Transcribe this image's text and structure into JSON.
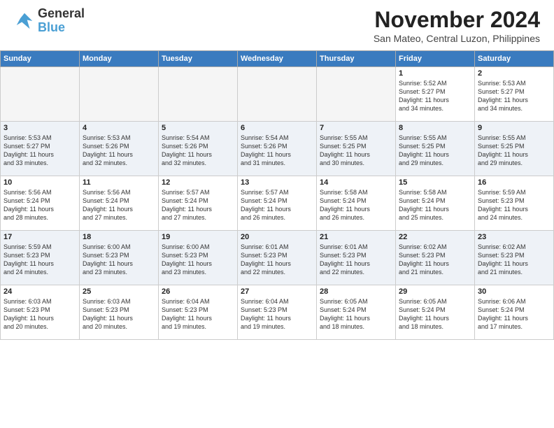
{
  "header": {
    "logo_text_general": "General",
    "logo_text_blue": "Blue",
    "month": "November 2024",
    "location": "San Mateo, Central Luzon, Philippines"
  },
  "calendar": {
    "days_of_week": [
      "Sunday",
      "Monday",
      "Tuesday",
      "Wednesday",
      "Thursday",
      "Friday",
      "Saturday"
    ],
    "weeks": [
      [
        {
          "day": "",
          "info": ""
        },
        {
          "day": "",
          "info": ""
        },
        {
          "day": "",
          "info": ""
        },
        {
          "day": "",
          "info": ""
        },
        {
          "day": "",
          "info": ""
        },
        {
          "day": "1",
          "info": "Sunrise: 5:52 AM\nSunset: 5:27 PM\nDaylight: 11 hours\nand 34 minutes."
        },
        {
          "day": "2",
          "info": "Sunrise: 5:53 AM\nSunset: 5:27 PM\nDaylight: 11 hours\nand 34 minutes."
        }
      ],
      [
        {
          "day": "3",
          "info": "Sunrise: 5:53 AM\nSunset: 5:27 PM\nDaylight: 11 hours\nand 33 minutes."
        },
        {
          "day": "4",
          "info": "Sunrise: 5:53 AM\nSunset: 5:26 PM\nDaylight: 11 hours\nand 32 minutes."
        },
        {
          "day": "5",
          "info": "Sunrise: 5:54 AM\nSunset: 5:26 PM\nDaylight: 11 hours\nand 32 minutes."
        },
        {
          "day": "6",
          "info": "Sunrise: 5:54 AM\nSunset: 5:26 PM\nDaylight: 11 hours\nand 31 minutes."
        },
        {
          "day": "7",
          "info": "Sunrise: 5:55 AM\nSunset: 5:25 PM\nDaylight: 11 hours\nand 30 minutes."
        },
        {
          "day": "8",
          "info": "Sunrise: 5:55 AM\nSunset: 5:25 PM\nDaylight: 11 hours\nand 29 minutes."
        },
        {
          "day": "9",
          "info": "Sunrise: 5:55 AM\nSunset: 5:25 PM\nDaylight: 11 hours\nand 29 minutes."
        }
      ],
      [
        {
          "day": "10",
          "info": "Sunrise: 5:56 AM\nSunset: 5:24 PM\nDaylight: 11 hours\nand 28 minutes."
        },
        {
          "day": "11",
          "info": "Sunrise: 5:56 AM\nSunset: 5:24 PM\nDaylight: 11 hours\nand 27 minutes."
        },
        {
          "day": "12",
          "info": "Sunrise: 5:57 AM\nSunset: 5:24 PM\nDaylight: 11 hours\nand 27 minutes."
        },
        {
          "day": "13",
          "info": "Sunrise: 5:57 AM\nSunset: 5:24 PM\nDaylight: 11 hours\nand 26 minutes."
        },
        {
          "day": "14",
          "info": "Sunrise: 5:58 AM\nSunset: 5:24 PM\nDaylight: 11 hours\nand 26 minutes."
        },
        {
          "day": "15",
          "info": "Sunrise: 5:58 AM\nSunset: 5:24 PM\nDaylight: 11 hours\nand 25 minutes."
        },
        {
          "day": "16",
          "info": "Sunrise: 5:59 AM\nSunset: 5:23 PM\nDaylight: 11 hours\nand 24 minutes."
        }
      ],
      [
        {
          "day": "17",
          "info": "Sunrise: 5:59 AM\nSunset: 5:23 PM\nDaylight: 11 hours\nand 24 minutes."
        },
        {
          "day": "18",
          "info": "Sunrise: 6:00 AM\nSunset: 5:23 PM\nDaylight: 11 hours\nand 23 minutes."
        },
        {
          "day": "19",
          "info": "Sunrise: 6:00 AM\nSunset: 5:23 PM\nDaylight: 11 hours\nand 23 minutes."
        },
        {
          "day": "20",
          "info": "Sunrise: 6:01 AM\nSunset: 5:23 PM\nDaylight: 11 hours\nand 22 minutes."
        },
        {
          "day": "21",
          "info": "Sunrise: 6:01 AM\nSunset: 5:23 PM\nDaylight: 11 hours\nand 22 minutes."
        },
        {
          "day": "22",
          "info": "Sunrise: 6:02 AM\nSunset: 5:23 PM\nDaylight: 11 hours\nand 21 minutes."
        },
        {
          "day": "23",
          "info": "Sunrise: 6:02 AM\nSunset: 5:23 PM\nDaylight: 11 hours\nand 21 minutes."
        }
      ],
      [
        {
          "day": "24",
          "info": "Sunrise: 6:03 AM\nSunset: 5:23 PM\nDaylight: 11 hours\nand 20 minutes."
        },
        {
          "day": "25",
          "info": "Sunrise: 6:03 AM\nSunset: 5:23 PM\nDaylight: 11 hours\nand 20 minutes."
        },
        {
          "day": "26",
          "info": "Sunrise: 6:04 AM\nSunset: 5:23 PM\nDaylight: 11 hours\nand 19 minutes."
        },
        {
          "day": "27",
          "info": "Sunrise: 6:04 AM\nSunset: 5:23 PM\nDaylight: 11 hours\nand 19 minutes."
        },
        {
          "day": "28",
          "info": "Sunrise: 6:05 AM\nSunset: 5:24 PM\nDaylight: 11 hours\nand 18 minutes."
        },
        {
          "day": "29",
          "info": "Sunrise: 6:05 AM\nSunset: 5:24 PM\nDaylight: 11 hours\nand 18 minutes."
        },
        {
          "day": "30",
          "info": "Sunrise: 6:06 AM\nSunset: 5:24 PM\nDaylight: 11 hours\nand 17 minutes."
        }
      ]
    ]
  }
}
